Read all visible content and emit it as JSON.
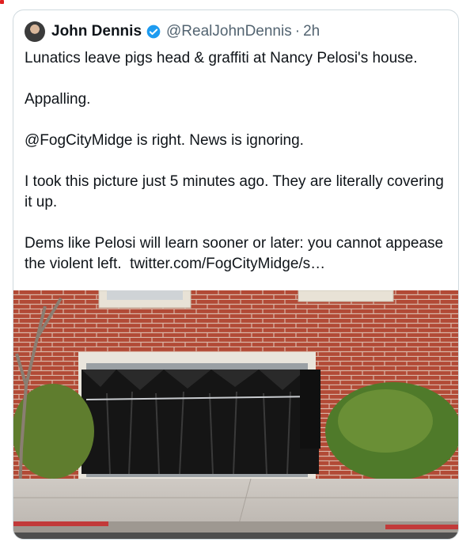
{
  "author": {
    "name": "John Dennis",
    "handle": "@RealJohnDennis",
    "separator": "·",
    "time": "2h",
    "verified": true,
    "avatar_icon": "profile-photo",
    "verified_icon": "verified-badge-icon",
    "verified_color": "#1d9bf0"
  },
  "tweet": {
    "lines": [
      "Lunatics leave pigs head & graffiti at Nancy Pelosi's house.",
      "Appalling.",
      "@FogCityMidge is right. News is ignoring.",
      "I took this picture just 5 minutes ago. They are literally covering it up.",
      "Dems like Pelosi will learn sooner or later: you cannot appease the violent left."
    ],
    "link": "twitter.com/FogCityMidge/s…"
  },
  "media": {
    "description_icon": "photo-brick-house-garage-covered-black-bags"
  }
}
